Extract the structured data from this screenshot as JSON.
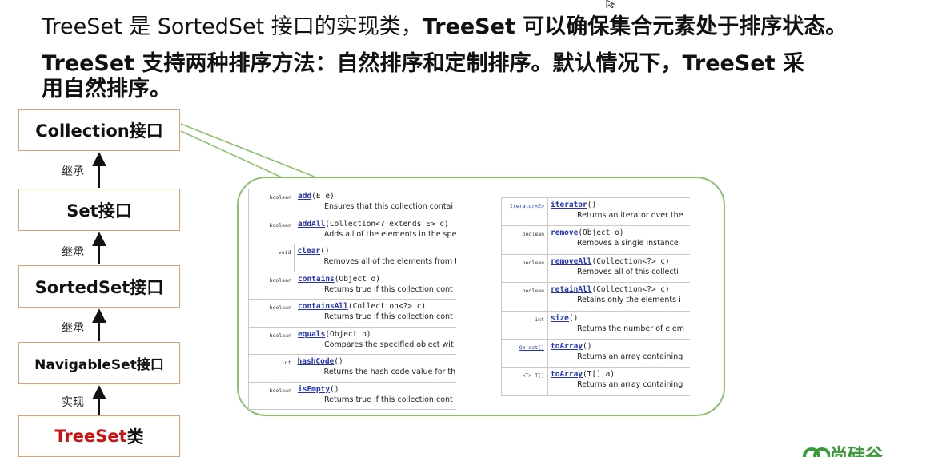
{
  "heading": {
    "line1_part1": "TreeSet 是 SortedSet 接口的实现类，",
    "line1_part2": "TreeSet 可以确保集合元素处于排序状态。",
    "line2": "TreeSet 支持两种排序方法：自然排序和定制排序。默认情况下，TreeSet 采",
    "line3": "用自然排序。"
  },
  "hierarchy": {
    "boxes": [
      {
        "label": "Collection接口"
      },
      {
        "label": "Set接口"
      },
      {
        "label": "SortedSet接口"
      },
      {
        "label": "NavigableSet接口"
      },
      {
        "label_red": "TreeSet",
        "label_suffix": "类"
      }
    ],
    "relations": [
      "继承",
      "继承",
      "继承",
      "实现"
    ]
  },
  "api_left": [
    {
      "type": "boolean",
      "name": "add",
      "params": "(E e)",
      "desc": "Ensures that this collection contai"
    },
    {
      "type": "boolean",
      "name": "addAll",
      "params": "(Collection<? extends E> c)",
      "desc": "Adds all of the elements in the spe"
    },
    {
      "type": "void",
      "name": "clear",
      "params": "()",
      "desc": "Removes all of the elements from t"
    },
    {
      "type": "boolean",
      "name": "contains",
      "params": "(Object o)",
      "desc": "Returns true if this collection cont"
    },
    {
      "type": "boolean",
      "name": "containsAll",
      "params": "(Collection<?> c)",
      "desc": "Returns true if this collection cont"
    },
    {
      "type": "boolean",
      "name": "equals",
      "params": "(Object o)",
      "desc": "Compares the specified object wit"
    },
    {
      "type": "int",
      "name": "hashCode",
      "params": "()",
      "desc": "Returns the hash code value for thi"
    },
    {
      "type": "boolean",
      "name": "isEmpty",
      "params": "()",
      "desc": "Returns true if this collection cont"
    }
  ],
  "api_right": [
    {
      "type": "Iterator<E>",
      "type_link": true,
      "name": "iterator",
      "params": "()",
      "desc": "Returns an iterator over the"
    },
    {
      "type": "boolean",
      "name": "remove",
      "params": "(Object o)",
      "desc": "Removes a single instance"
    },
    {
      "type": "boolean",
      "name": "removeAll",
      "params": "(Collection<?> c)",
      "desc": "Removes all of this collecti"
    },
    {
      "type": "boolean",
      "name": "retainAll",
      "params": "(Collection<?> c)",
      "desc": "Retains only the elements i"
    },
    {
      "type": "int",
      "name": "size",
      "params": "()",
      "desc": "Returns the number of elem"
    },
    {
      "type": "Object[]",
      "type_link": true,
      "name": "toArray",
      "params": "()",
      "desc": "Returns an array containing"
    },
    {
      "type": "<T> T[]",
      "name": "toArray",
      "params": "(T[] a)",
      "desc": "Returns an array containing"
    }
  ],
  "logo_text": "尚硅谷",
  "colors": {
    "box_border": "#e0a070",
    "callout_border": "#8cc070",
    "link_blue": "#2233bb",
    "treeset_red": "#cc1111"
  }
}
